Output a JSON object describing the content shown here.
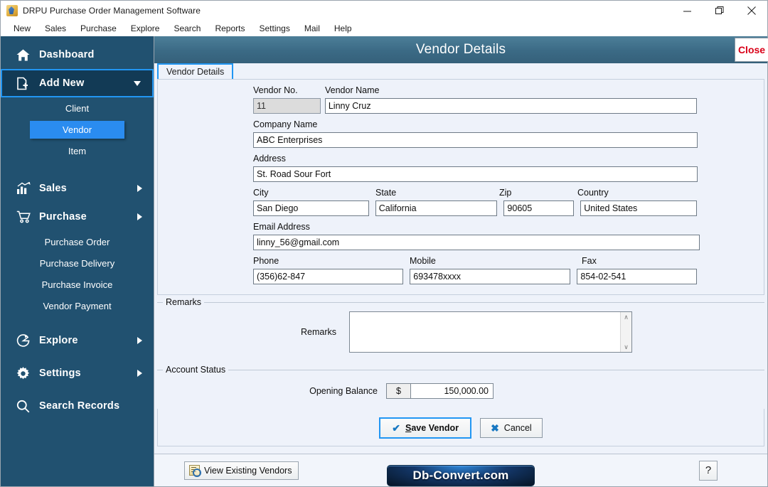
{
  "window": {
    "title": "DRPU Purchase Order Management Software",
    "icon": "app-icon",
    "minimize_label": "—",
    "maximize_label": "❐",
    "close_label": "✕"
  },
  "menubar": {
    "items": [
      {
        "label": "New"
      },
      {
        "label": "Sales"
      },
      {
        "label": "Purchase"
      },
      {
        "label": "Explore"
      },
      {
        "label": "Search"
      },
      {
        "label": "Reports"
      },
      {
        "label": "Settings"
      },
      {
        "label": "Mail"
      },
      {
        "label": "Help"
      }
    ]
  },
  "sidebar": {
    "background_color": "#215170",
    "selected_color": "#2a8cf0",
    "focus_color": "#2196f3",
    "items": [
      {
        "label": "Dashboard",
        "icon": "home-icon",
        "expandable": false,
        "state": "normal"
      },
      {
        "label": "Add New",
        "icon": "document-plus-icon",
        "expandable": true,
        "state": "focused-expanded"
      },
      {
        "label": "Client",
        "icon": "",
        "type": "sub",
        "state": "normal"
      },
      {
        "label": "Vendor",
        "icon": "",
        "type": "sub",
        "state": "selected"
      },
      {
        "label": "Item",
        "icon": "",
        "type": "sub",
        "state": "normal"
      },
      {
        "label": "Sales",
        "icon": "bar-chart-icon",
        "expandable": true,
        "state": "normal"
      },
      {
        "label": "Purchase",
        "icon": "cart-icon",
        "expandable": true,
        "state": "normal"
      },
      {
        "label": "Purchase Order",
        "icon": "",
        "type": "sub",
        "state": "normal"
      },
      {
        "label": "Purchase Delivery",
        "icon": "",
        "type": "sub",
        "state": "normal"
      },
      {
        "label": "Purchase Invoice",
        "icon": "",
        "type": "sub",
        "state": "normal"
      },
      {
        "label": "Vendor Payment",
        "icon": "",
        "type": "sub",
        "state": "normal"
      },
      {
        "label": "Explore",
        "icon": "pie-chart-icon",
        "expandable": true,
        "state": "normal"
      },
      {
        "label": "Settings",
        "icon": "gear-icon",
        "expandable": true,
        "state": "normal"
      },
      {
        "label": "Search Records",
        "icon": "search-icon",
        "expandable": false,
        "state": "normal"
      }
    ]
  },
  "form": {
    "header_title": "Vendor Details",
    "header_color": "#3d6c87",
    "close_button": "Close",
    "close_color": "#d90018",
    "tab": "Vendor Details",
    "fields": {
      "vendor_no_label": "Vendor No.",
      "vendor_no_value": "11",
      "vendor_name_label": "Vendor Name",
      "vendor_name_value": "Linny Cruz",
      "company_name_label": "Company Name",
      "company_name_value": "ABC Enterprises",
      "address_label": "Address",
      "address_value": "St. Road Sour Fort",
      "city_label": "City",
      "city_value": "San Diego",
      "state_label": "State",
      "state_value": "California",
      "zip_label": "Zip",
      "zip_value": "90605",
      "country_label": "Country",
      "country_value": "United States",
      "email_label": "Email Address",
      "email_value": "linny_56@gmail.com",
      "phone_label": "Phone",
      "phone_value": "(356)62-847",
      "mobile_label": "Mobile",
      "mobile_value": "693478xxxx",
      "fax_label": "Fax",
      "fax_value": "854-02-541"
    },
    "remarks": {
      "group_title": "Remarks",
      "field_label": "Remarks",
      "value": "",
      "scroll_up": "∧",
      "scroll_down": "∨"
    },
    "account_status": {
      "group_title": "Account Status",
      "opening_balance_label": "Opening Balance",
      "currency_symbol": "$",
      "opening_balance_value": "150,000.00"
    },
    "actions": {
      "save_label_accel": "S",
      "save_label_rest": "ave Vendor",
      "save_icon": "check-icon",
      "cancel_label": "Cancel",
      "cancel_icon": "x-icon"
    }
  },
  "footer": {
    "view_existing_label": "View Existing Vendors",
    "view_existing_icon": "document-search-icon",
    "brand": "Db-Convert.com",
    "help_label": "?"
  }
}
